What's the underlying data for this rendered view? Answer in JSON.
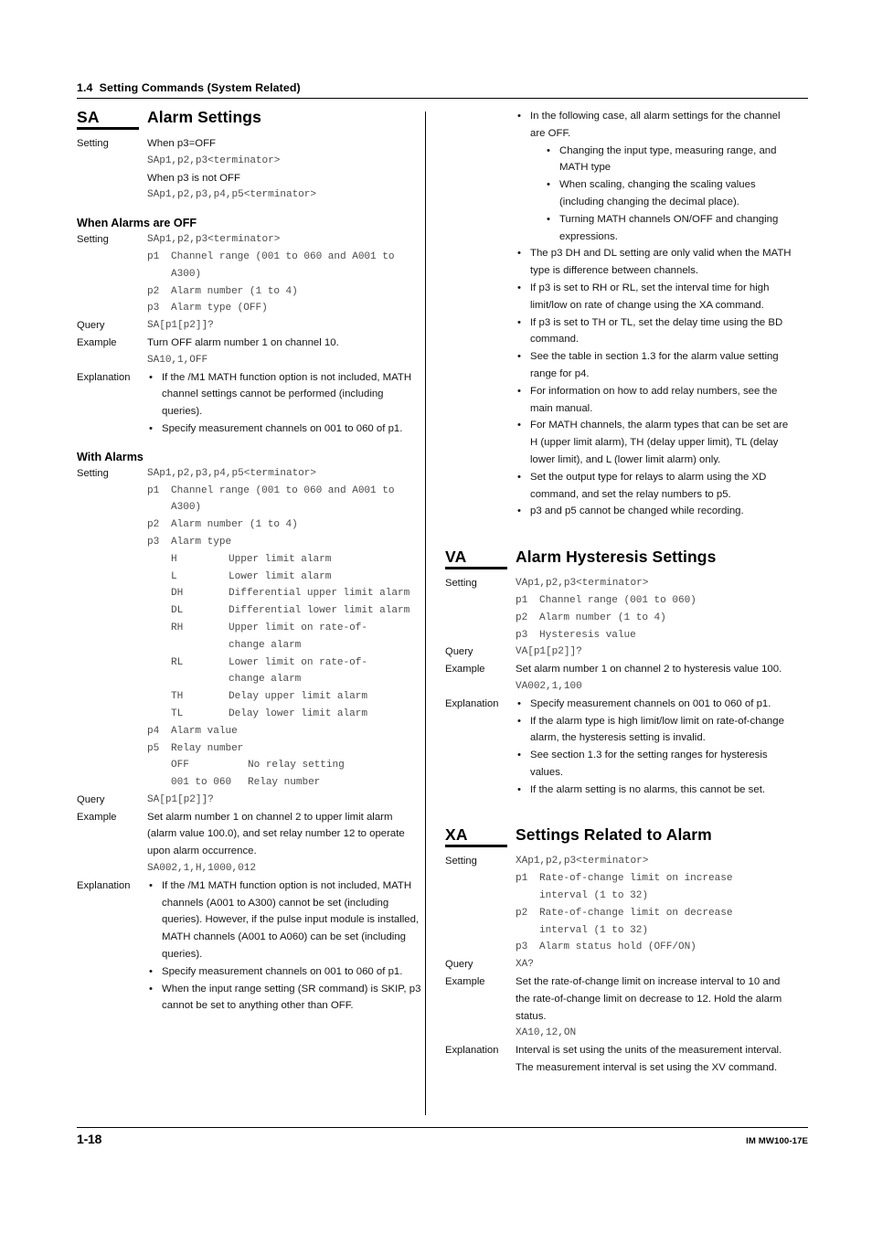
{
  "running_head": "1.4  Setting Commands (System Related)",
  "footer": {
    "page_number": "1-18",
    "doc_number": "IM MW100-17E"
  },
  "left_column": {
    "sa": {
      "code": "SA",
      "title": "Alarm Settings",
      "setting_label": "Setting",
      "line_p3_off": "When p3=OFF",
      "syntax_p3_off": "SAp1,p2,p3<terminator>",
      "line_p3_not_off": "When p3 is not OFF",
      "syntax_p3_not_off": "SAp1,p2,p3,p4,p5<terminator>"
    },
    "alarms_off": {
      "heading": "When Alarms are OFF",
      "setting_label": "Setting",
      "query_label": "Query",
      "example_label": "Example",
      "explanation_label": "Explanation",
      "syntax": "SAp1,p2,p3<terminator>",
      "params": [
        {
          "key": "p1",
          "value": "Channel range (001 to 060 and A001 to\nA300)"
        },
        {
          "key": "p2",
          "value": "Alarm number (1 to 4)"
        },
        {
          "key": "p3",
          "value": "Alarm type (OFF)"
        }
      ],
      "query": "SA[p1[p2]]?",
      "example_text": "Turn OFF alarm number 1 on channel 10.",
      "example_code": "SA10,1,OFF",
      "explanation": [
        "If the /M1 MATH function option is not included, MATH channel settings cannot be performed (including queries).",
        "Specify measurement channels on 001 to 060 of p1."
      ]
    },
    "with_alarms": {
      "heading": "With Alarms",
      "setting_label": "Setting",
      "query_label": "Query",
      "example_label": "Example",
      "explanation_label": "Explanation",
      "syntax": "SAp1,p2,p3,p4,p5<terminator>",
      "params": [
        {
          "key": "p1",
          "value": "Channel range (001 to 060 and A001 to\nA300)"
        },
        {
          "key": "p2",
          "value": "Alarm number (1 to 4)"
        },
        {
          "key": "p3",
          "value": "Alarm type"
        }
      ],
      "alarm_types": [
        {
          "code": "H",
          "desc": "Upper limit alarm"
        },
        {
          "code": "L",
          "desc": "Lower limit alarm"
        },
        {
          "code": "DH",
          "desc": "Differential upper limit alarm"
        },
        {
          "code": "DL",
          "desc": "Differential lower limit alarm"
        },
        {
          "code": "RH",
          "desc": "Upper limit on rate-of-\nchange alarm"
        },
        {
          "code": "RL",
          "desc": "Lower limit on rate-of-\nchange alarm"
        },
        {
          "code": "TH",
          "desc": "Delay upper limit alarm"
        },
        {
          "code": "TL",
          "desc": "Delay lower limit alarm"
        }
      ],
      "params_tail": [
        {
          "key": "p4",
          "value": "Alarm value"
        },
        {
          "key": "p5",
          "value": "Relay number"
        }
      ],
      "relay_values": [
        {
          "code": "OFF",
          "desc": "No relay setting"
        },
        {
          "code": "001 to 060",
          "desc": "Relay number"
        }
      ],
      "query": "SA[p1[p2]]?",
      "example_text": "Set alarm number 1 on channel 2 to upper limit alarm (alarm value  100.0), and set relay number 12 to operate upon alarm occurrence.",
      "example_code": "SA002,1,H,1000,012",
      "explanation": [
        "If the /M1 MATH function option is not included, MATH channels (A001 to A300) cannot be set (including queries). However, if the pulse input module is installed, MATH channels (A001 to A060) can be set (including queries).",
        "Specify measurement channels on 001 to 060 of p1.",
        "When the input range setting (SR command) is SKIP, p3 cannot be set to anything other than OFF."
      ]
    }
  },
  "right_column": {
    "sa_notes": [
      {
        "text": "In the following case, all alarm settings for the channel are OFF.",
        "sub": [
          "Changing the input type, measuring range, and MATH type",
          "When scaling, changing the scaling values (including changing the decimal place).",
          "Turning MATH channels ON/OFF and changing expressions."
        ]
      },
      {
        "text": "The p3 DH and DL setting are only valid when the MATH type is difference between channels."
      },
      {
        "text": "If p3 is set to RH or RL, set the interval time for high limit/low on rate of change using the XA command."
      },
      {
        "text": "If p3 is set to TH or TL, set the delay time using the BD command."
      },
      {
        "text": "See the table in section 1.3 for the alarm value setting range for p4."
      },
      {
        "text": "For information on how to add relay numbers, see the main manual."
      },
      {
        "text": "For MATH channels, the alarm types that can be set are H (upper limit alarm), TH (delay upper limit), TL (delay lower limit), and L (lower limit alarm) only."
      },
      {
        "text": "Set the output type for relays to alarm using the XD command, and set the relay numbers to p5."
      },
      {
        "text": "p3 and p5 cannot be changed while recording."
      }
    ],
    "va": {
      "code": "VA",
      "title": "Alarm Hysteresis Settings",
      "setting_label": "Setting",
      "query_label": "Query",
      "example_label": "Example",
      "explanation_label": "Explanation",
      "syntax": "VAp1,p2,p3<terminator>",
      "params": [
        {
          "key": "p1",
          "value": "Channel range (001 to 060)"
        },
        {
          "key": "p2",
          "value": "Alarm number (1 to 4)"
        },
        {
          "key": "p3",
          "value": "Hysteresis value"
        }
      ],
      "query": "VA[p1[p2]]?",
      "example_text": "Set alarm number 1 on channel 2 to hysteresis value 100.",
      "example_code": "VA002,1,100",
      "explanation": [
        "Specify measurement channels on 001 to 060 of p1.",
        "If the alarm type is high limit/low limit on rate-of-change alarm, the hysteresis setting is invalid.",
        "See section 1.3 for the setting ranges for hysteresis values.",
        "If the alarm setting is no alarms, this cannot be set."
      ]
    },
    "xa": {
      "code": "XA",
      "title": "Settings Related to Alarm",
      "setting_label": "Setting",
      "query_label": "Query",
      "example_label": "Example",
      "explanation_label": "Explanation",
      "syntax": "XAp1,p2,p3<terminator>",
      "params": [
        {
          "key": "p1",
          "value": "Rate-of-change limit on increase\ninterval (1 to 32)"
        },
        {
          "key": "p2",
          "value": "Rate-of-change limit on decrease\ninterval (1 to 32)"
        },
        {
          "key": "p3",
          "value": "Alarm status hold (OFF/ON)"
        }
      ],
      "query": "XA?",
      "example_text": "Set the rate-of-change limit on increase interval to 10 and the rate-of-change limit on decrease to 12. Hold the alarm status.",
      "example_code": "XA10,12,ON",
      "explanation_text": "Interval is set using the units of the measurement interval. The measurement interval is set using the XV command."
    }
  }
}
